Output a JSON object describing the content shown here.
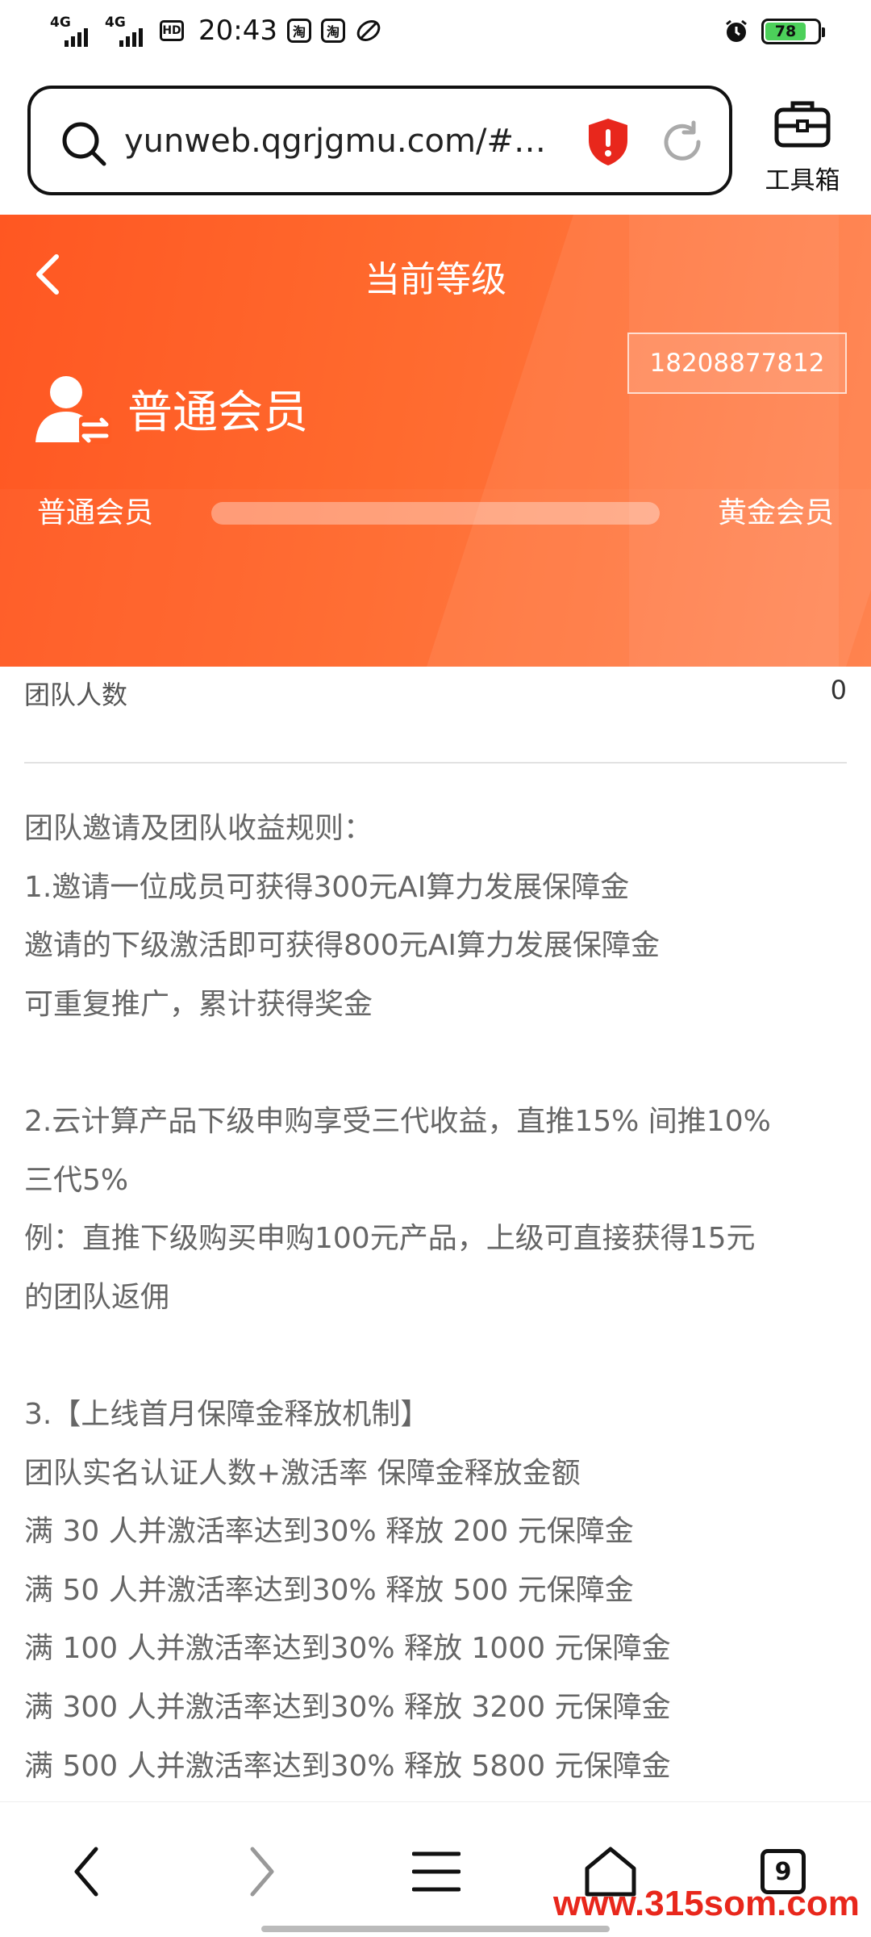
{
  "status_bar": {
    "net1": "4G",
    "net2": "4G",
    "hd": "HD",
    "time": "20:43",
    "app_icon_1": "淘",
    "app_icon_2": "淘",
    "battery": "78"
  },
  "browser": {
    "url": "yunweb.qgrjgmu.com/#…",
    "toolbox_label": "工具箱"
  },
  "header": {
    "title": "当前等级",
    "phone": "18208877812",
    "member_level": "普通会员",
    "level_from": "普通会员",
    "level_to": "黄金会员",
    "progress": 0
  },
  "team": {
    "label": "团队人数",
    "count": "0"
  },
  "rules": {
    "lines": [
      "团队邀请及团队收益规则：",
      "1.邀请一位成员可获得300元AI算力发展保障金",
      "邀请的下级激活即可获得800元AI算力发展保障金",
      "可重复推广，累计获得奖金",
      "",
      "2.云计算产品下级申购享受三代收益，直推15% 间推10%",
      "三代5%",
      "例：直推下级购买申购100元产品，上级可直接获得15元",
      "的团队返佣",
      "",
      "3.【上线首月保障金释放机制】",
      "团队实名认证人数+激活率 保障金释放金额",
      "满 30 人并激活率达到30% 释放 200 元保障金",
      "满 50 人并激活率达到30% 释放 500 元保障金",
      "满 100 人并激活率达到30% 释放 1000 元保障金",
      "满 300 人并激活率达到30% 释放 3200 元保障金",
      "满 500 人并激活率达到30% 释放 5800 元保障金"
    ]
  },
  "bottom_nav": {
    "tab_count": "9",
    "watermark": "www.315som.com"
  },
  "colors": {
    "brand_orange": "#ff5722",
    "watermark_red": "#e8271c"
  }
}
